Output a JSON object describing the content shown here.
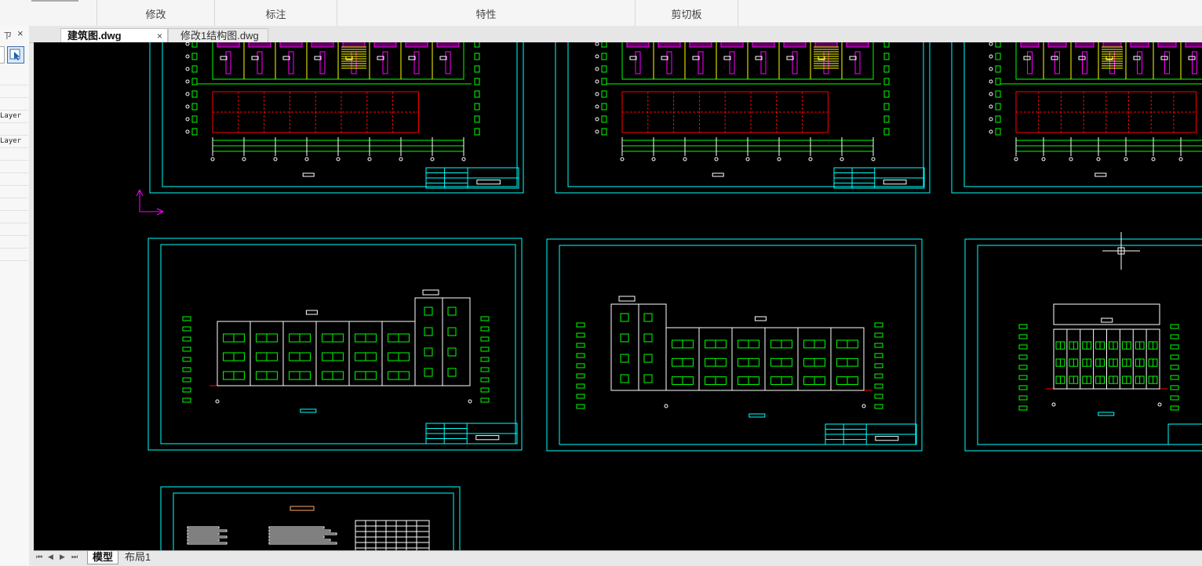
{
  "ribbon": {
    "groups": [
      {
        "label": "修改"
      },
      {
        "label": "标注"
      },
      {
        "label": "特性"
      },
      {
        "label": "剪切板"
      }
    ]
  },
  "panel": {
    "pin_glyph": "ㄗ",
    "close_glyph": "×",
    "rows": [
      "",
      "",
      "",
      "Layer",
      "",
      "Layer",
      "",
      "",
      "",
      "",
      "",
      "",
      "",
      "",
      ""
    ]
  },
  "tabs": [
    {
      "label": "建筑图.dwg",
      "close": "×",
      "active": true
    },
    {
      "label": "修改1结构图.dwg",
      "active": false
    }
  ],
  "layout_tabs": [
    {
      "label": "模型",
      "active": true
    },
    {
      "label": "布局1",
      "active": false
    }
  ],
  "nav_arrows": [
    "⏮",
    "◀",
    "▶",
    "⏭"
  ],
  "colors": {
    "canvas_bg": "#000000",
    "frame": "#00ffff",
    "wall": "#00ff00",
    "grid_line": "#ff0000",
    "furniture": "#ff00ff",
    "stair": "#ffff00",
    "white": "#ffffff",
    "ucs": "#ff00ff"
  }
}
